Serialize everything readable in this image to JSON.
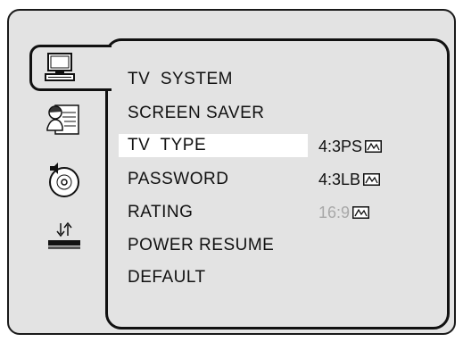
{
  "sidebar": {
    "items": [
      {
        "name": "general-setup",
        "icon": "monitor-icon",
        "selected": true
      },
      {
        "name": "language-setup",
        "icon": "person-document-icon",
        "selected": false
      },
      {
        "name": "audio-setup",
        "icon": "speaker-disc-icon",
        "selected": false
      },
      {
        "name": "preference-setup",
        "icon": "transfer-device-icon",
        "selected": false
      }
    ]
  },
  "menu": {
    "items": [
      {
        "label": "TV  SYSTEM"
      },
      {
        "label": "SCREEN SAVER"
      },
      {
        "label": "TV  TYPE",
        "highlighted": true
      },
      {
        "label": "PASSWORD"
      },
      {
        "label": "RATING"
      },
      {
        "label": "POWER RESUME"
      },
      {
        "label": "DEFAULT"
      }
    ]
  },
  "submenu": {
    "options": [
      {
        "label": "4:3PS",
        "icon": "aspect-ratio-icon",
        "enabled": true
      },
      {
        "label": "4:3LB",
        "icon": "aspect-ratio-icon",
        "enabled": true
      },
      {
        "label": "16:9",
        "icon": "aspect-ratio-icon",
        "enabled": false
      }
    ]
  },
  "colors": {
    "background": "#e3e3e3",
    "highlight": "#ffffff",
    "text": "#111111",
    "disabled_text": "#a8a8a8",
    "border": "#111111"
  }
}
